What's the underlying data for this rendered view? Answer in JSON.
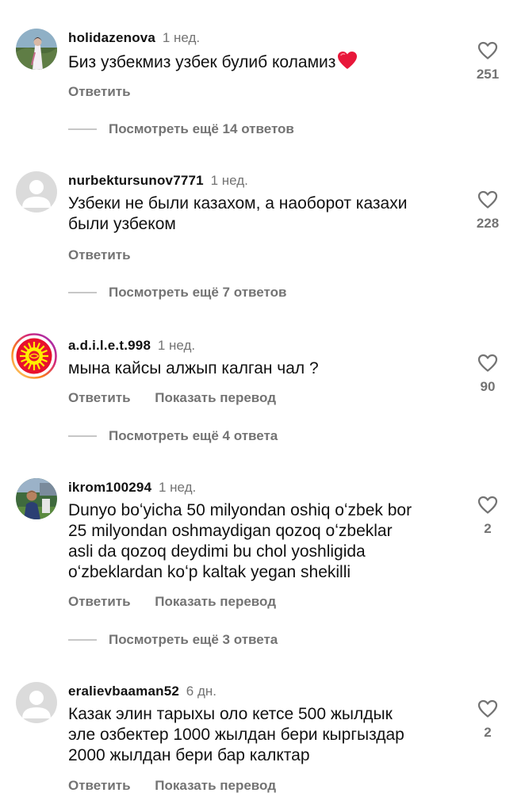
{
  "ui": {
    "reply_label": "Ответить",
    "translate_label": "Показать перевод"
  },
  "comments": [
    {
      "username": "holidazenova",
      "time": "1 нед.",
      "lines": [
        "Биз узбекмиз узбек булиб коламиз"
      ],
      "emoji": "red-heart-emoji",
      "likes": "251",
      "more_replies": "Посмотреть ещё 14 ответов",
      "avatar": "photo"
    },
    {
      "username": "nurbektursunov7771",
      "time": "1 нед.",
      "lines": [
        "Узбеки не были казахом, а наоборот казахи",
        "были узбеком"
      ],
      "likes": "228",
      "more_replies": "Посмотреть ещё 7 ответов",
      "avatar": "default-user"
    },
    {
      "username": "a.d.i.l.e.t.998",
      "time": "1 нед.",
      "lines": [
        "мына кайсы алжып калган чал ?"
      ],
      "likes": "90",
      "more_replies": "Посмотреть ещё 4 ответа",
      "avatar": "kyrgyz-flag-story-ring"
    },
    {
      "username": "ikrom100294",
      "time": "1 нед.",
      "lines": [
        "Dunyo boʻyicha 50 milyondan oshiq oʻzbek bor",
        "25 milyondan oshmaydigan qozoq oʻzbeklar",
        "asli da qozoq deydimi bu chol yoshligida",
        "oʻzbeklardan koʻp kaltak yegan shekilli"
      ],
      "likes": "2",
      "more_replies": "Посмотреть ещё 3 ответа",
      "avatar": "photo"
    },
    {
      "username": "eralievbaaman52",
      "time": "6 дн.",
      "lines": [
        "Казак элин тарыхы оло кетсе 500 жылдык",
        "эле озбектер 1000 жылдан бери кыргыздар",
        "2000 жылдан бери бар калктар"
      ],
      "likes": "2",
      "avatar": "default-user"
    }
  ],
  "colors": {
    "text": "#111111",
    "secondary": "#737373",
    "heart_red": "#e8173a",
    "flag_red": "#e8112d",
    "flag_sun": "#ffef00"
  }
}
